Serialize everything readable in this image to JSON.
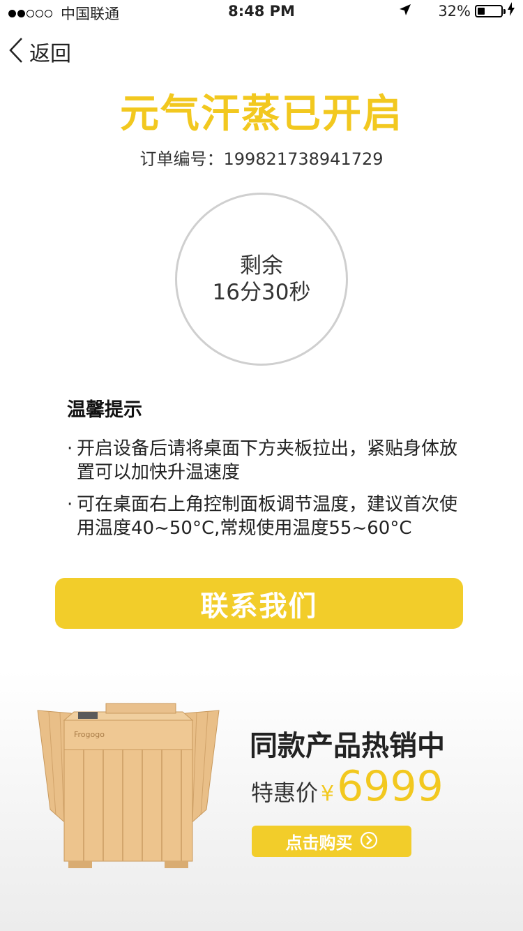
{
  "status_bar": {
    "carrier": "中国联通",
    "time": "8:48 PM",
    "battery_percent": "32%",
    "battery_level": 0.32,
    "signal_bars_filled": 2,
    "signal_bars_total": 5
  },
  "nav": {
    "back_label": "返回",
    "back_icon": "chevron-left-icon"
  },
  "header": {
    "title": "元气汗蒸已开启",
    "order_label": "订单编号：",
    "order_number": "199821738941729"
  },
  "timer": {
    "label": "剩余",
    "value": "16分30秒"
  },
  "tips": {
    "title": "温馨提示",
    "bullet": "·",
    "items": [
      "开启设备后请将桌面下方夹板拉出，紧贴身体放置可以加快升温速度",
      "可在桌面右上角控制面板调节温度，建议首次使用温度40~50°C,常规使用温度55~60°C"
    ]
  },
  "contact": {
    "label": "联系我们"
  },
  "promo": {
    "title": "同款产品热销中",
    "price_label": "特惠价",
    "currency": "¥",
    "price": "6999",
    "buy_label": "点击购买",
    "buy_icon": "circle-arrow-right-icon",
    "brand_mark": "Frogogo"
  },
  "colors": {
    "accent": "#f2c81f",
    "button": "#f2cd2a",
    "circle_border": "#cfcfcf"
  }
}
